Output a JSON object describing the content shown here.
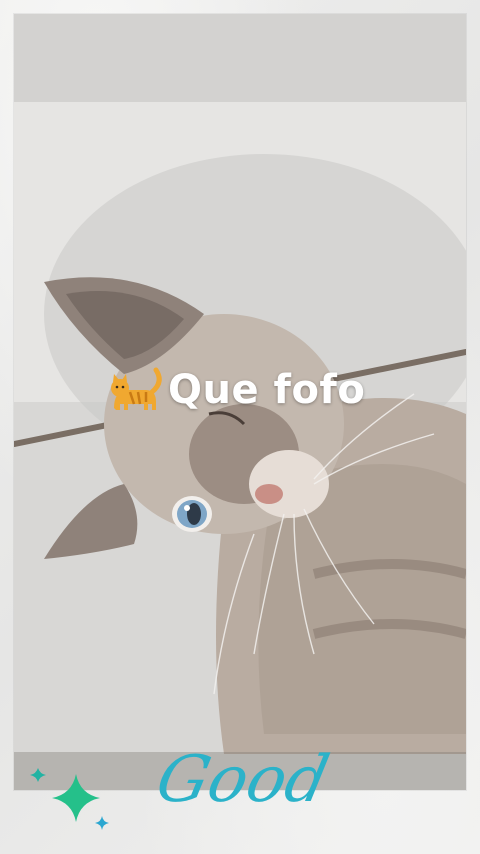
{
  "caption": {
    "text": "Que fofo",
    "emoji": "cat-emoji"
  },
  "sticker": {
    "text": "Good",
    "icon": "sparkle-icon",
    "color": "#2bb2c9"
  },
  "photo": {
    "subject": "cat-photo"
  }
}
